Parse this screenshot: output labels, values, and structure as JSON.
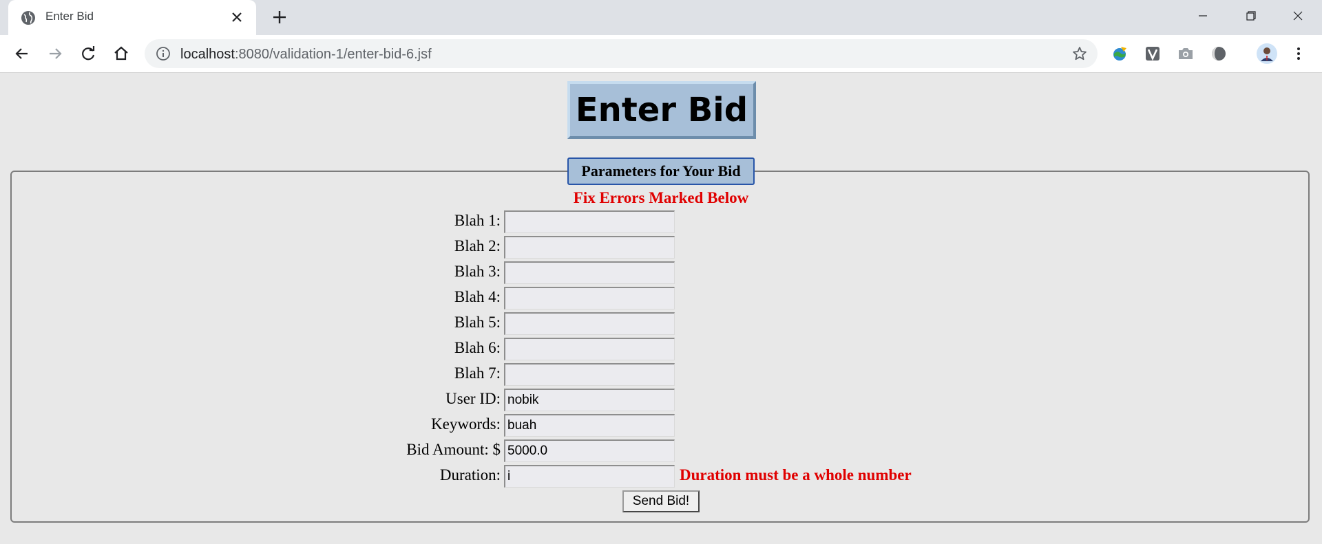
{
  "browser": {
    "tab_title": "Enter Bid",
    "url_host": "localhost",
    "url_path": ":8080/validation-1/enter-bid-6.jsf",
    "icons": [
      "globe-icon",
      "close-icon",
      "plus-icon",
      "minimize-icon",
      "restore-icon",
      "window-close-icon",
      "back-icon",
      "forward-icon",
      "reload-icon",
      "home-icon",
      "info-icon",
      "star-icon",
      "menu-icon"
    ]
  },
  "page": {
    "title": "Enter Bid",
    "legend": "Parameters for Your Bid",
    "errors_heading": "Fix Errors Marked Below",
    "fields": [
      {
        "label": "Blah 1:",
        "value": ""
      },
      {
        "label": "Blah 2:",
        "value": ""
      },
      {
        "label": "Blah 3:",
        "value": ""
      },
      {
        "label": "Blah 4:",
        "value": ""
      },
      {
        "label": "Blah 5:",
        "value": ""
      },
      {
        "label": "Blah 6:",
        "value": ""
      },
      {
        "label": "Blah 7:",
        "value": ""
      },
      {
        "label": "User ID:",
        "value": "nobik"
      },
      {
        "label": "Keywords:",
        "value": "buah"
      },
      {
        "label": "Bid Amount: $",
        "value": "5000.0"
      },
      {
        "label": "Duration:",
        "value": "i"
      }
    ],
    "duration_error": "Duration must be a whole number",
    "submit_label": "Send Bid!"
  },
  "colors": {
    "title_bg": "#a7bfd8",
    "error_red": "#e00000",
    "page_bg": "#e8e8e8"
  }
}
